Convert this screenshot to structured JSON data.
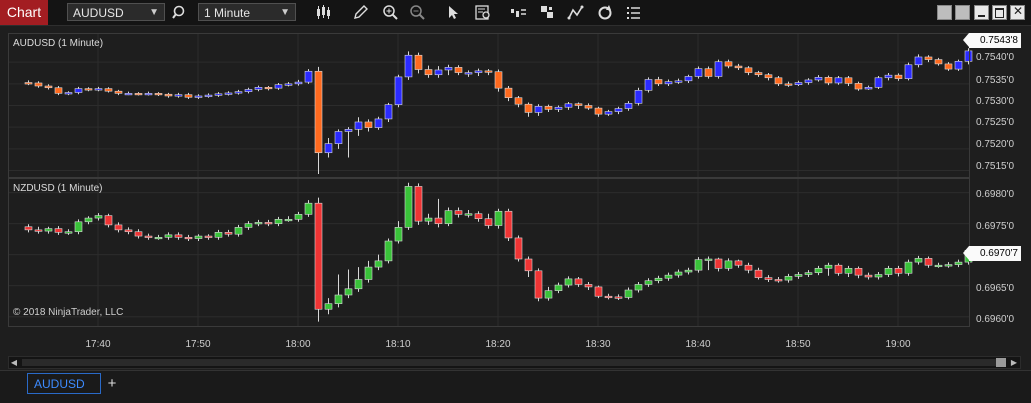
{
  "toolbar": {
    "title": "Chart",
    "instrument": "AUDUSD",
    "interval": "1 Minute"
  },
  "panels": [
    {
      "name": "AUDUSD (1 Minute)",
      "price_ticks": [
        "0.7540'0",
        "0.7535'0",
        "0.7530'0",
        "0.7525'0",
        "0.7520'0",
        "0.7515'0"
      ],
      "last_price": "0.7543'8"
    },
    {
      "name": "NZDUSD (1 Minute)",
      "price_ticks": [
        "0.6980'0",
        "0.6975'0",
        "0.6970'0",
        "0.6965'0",
        "0.6960'0"
      ],
      "last_price": "0.6970'7"
    }
  ],
  "copyright": "© 2018 NinjaTrader, LLC",
  "time_ticks": [
    "17:40",
    "17:50",
    "18:00",
    "18:10",
    "18:20",
    "18:30",
    "18:40",
    "18:50",
    "19:00"
  ],
  "tabs": [
    "AUDUSD"
  ],
  "colors": {
    "aud_up": "#2b2bff",
    "aud_down": "#ff6a1e",
    "nzd_up": "#39c239",
    "nzd_down": "#ef3434",
    "grid": "#2c2c2c"
  },
  "chart_data": [
    {
      "type": "candlestick",
      "title": "AUDUSD (1 Minute)",
      "x": [
        "17:31",
        "17:32",
        "17:33",
        "17:34",
        "17:35",
        "17:36",
        "17:37",
        "17:38",
        "17:39",
        "17:40",
        "17:41",
        "17:42",
        "17:43",
        "17:44",
        "17:45",
        "17:46",
        "17:47",
        "17:48",
        "17:49",
        "17:50",
        "17:51",
        "17:52",
        "17:53",
        "17:54",
        "17:55",
        "17:56",
        "17:57",
        "17:58",
        "17:59",
        "18:00",
        "18:01",
        "18:02",
        "18:03",
        "18:04",
        "18:05",
        "18:06",
        "18:07",
        "18:08",
        "18:09",
        "18:10",
        "18:11",
        "18:12",
        "18:13",
        "18:14",
        "18:15",
        "18:16",
        "18:17",
        "18:18",
        "18:19",
        "18:20",
        "18:21",
        "18:22",
        "18:23",
        "18:24",
        "18:25",
        "18:26",
        "18:27",
        "18:28",
        "18:29",
        "18:30",
        "18:31",
        "18:32",
        "18:33",
        "18:34",
        "18:35",
        "18:36",
        "18:37",
        "18:38",
        "18:39",
        "18:40",
        "18:41",
        "18:42",
        "18:43",
        "18:44",
        "18:45",
        "18:46",
        "18:47",
        "18:48",
        "18:49",
        "18:50",
        "18:51",
        "18:52",
        "18:53",
        "18:54",
        "18:55",
        "18:56",
        "18:57",
        "18:58",
        "18:59",
        "19:00",
        "19:01",
        "19:02",
        "19:03",
        "19:04",
        "19:05"
      ],
      "open": [
        0.75353,
        0.75352,
        0.75345,
        0.75341,
        0.75328,
        0.7533,
        0.75339,
        0.75337,
        0.75339,
        0.75333,
        0.75328,
        0.75328,
        0.75327,
        0.75328,
        0.75326,
        0.75322,
        0.75325,
        0.75319,
        0.75322,
        0.75324,
        0.75327,
        0.75329,
        0.75332,
        0.75337,
        0.75342,
        0.7534,
        0.75348,
        0.7535,
        0.75354,
        0.75379,
        0.75191,
        0.75212,
        0.7524,
        0.75245,
        0.75262,
        0.75249,
        0.75269,
        0.75302,
        0.75366,
        0.75416,
        0.75383,
        0.75371,
        0.75382,
        0.75388,
        0.75376,
        0.75376,
        0.7538,
        0.75378,
        0.7534,
        0.75318,
        0.75303,
        0.75284,
        0.75298,
        0.75291,
        0.75296,
        0.75304,
        0.753,
        0.75294,
        0.7528,
        0.75286,
        0.75293,
        0.75305,
        0.75335,
        0.7536,
        0.7535,
        0.75355,
        0.75357,
        0.75367,
        0.75385,
        0.75367,
        0.75401,
        0.75391,
        0.75387,
        0.75376,
        0.75371,
        0.75364,
        0.7535,
        0.75348,
        0.75353,
        0.75359,
        0.75365,
        0.75352,
        0.75364,
        0.75351,
        0.75338,
        0.75342,
        0.75364,
        0.7537,
        0.75362,
        0.75394,
        0.75412,
        0.75406,
        0.75396,
        0.75384,
        0.75402
      ],
      "close": [
        0.75352,
        0.75345,
        0.75341,
        0.75328,
        0.7533,
        0.75339,
        0.75337,
        0.75339,
        0.75333,
        0.75328,
        0.75328,
        0.75327,
        0.75328,
        0.75326,
        0.75322,
        0.75325,
        0.75319,
        0.75322,
        0.75324,
        0.75327,
        0.75329,
        0.75332,
        0.75337,
        0.75342,
        0.7534,
        0.75348,
        0.7535,
        0.75354,
        0.75379,
        0.75191,
        0.75212,
        0.7524,
        0.75245,
        0.75262,
        0.75249,
        0.75269,
        0.75302,
        0.75366,
        0.75416,
        0.75383,
        0.75371,
        0.75382,
        0.75388,
        0.75376,
        0.75376,
        0.7538,
        0.75378,
        0.7534,
        0.75318,
        0.75303,
        0.75284,
        0.75298,
        0.75291,
        0.75296,
        0.75304,
        0.753,
        0.75294,
        0.7528,
        0.75286,
        0.75293,
        0.75305,
        0.75335,
        0.7536,
        0.7535,
        0.75355,
        0.75357,
        0.75367,
        0.75385,
        0.75367,
        0.75401,
        0.75391,
        0.75387,
        0.75376,
        0.75371,
        0.75364,
        0.7535,
        0.75348,
        0.75353,
        0.75359,
        0.75365,
        0.75352,
        0.75364,
        0.75351,
        0.75338,
        0.75342,
        0.75364,
        0.7537,
        0.75362,
        0.75394,
        0.75412,
        0.75406,
        0.75396,
        0.75384,
        0.75402,
        0.75426
      ],
      "high": [
        0.75358,
        0.75356,
        0.75349,
        0.75345,
        0.75333,
        0.75343,
        0.75342,
        0.75343,
        0.75342,
        0.75336,
        0.75332,
        0.75331,
        0.75332,
        0.75331,
        0.75329,
        0.75329,
        0.75329,
        0.75326,
        0.75328,
        0.75331,
        0.75333,
        0.75336,
        0.75341,
        0.75346,
        0.75345,
        0.75352,
        0.75354,
        0.75359,
        0.75384,
        0.75389,
        0.75225,
        0.75245,
        0.7525,
        0.75273,
        0.75268,
        0.75274,
        0.75306,
        0.75371,
        0.75425,
        0.75422,
        0.75392,
        0.75391,
        0.75394,
        0.75393,
        0.75381,
        0.75385,
        0.75384,
        0.75383,
        0.75345,
        0.75322,
        0.75307,
        0.75303,
        0.75302,
        0.753,
        0.75308,
        0.75307,
        0.75305,
        0.75297,
        0.7529,
        0.75297,
        0.7531,
        0.75341,
        0.75365,
        0.75366,
        0.7536,
        0.75362,
        0.75371,
        0.7539,
        0.7539,
        0.75406,
        0.75406,
        0.75396,
        0.75391,
        0.7538,
        0.75375,
        0.75368,
        0.75355,
        0.75357,
        0.75363,
        0.7537,
        0.75369,
        0.75368,
        0.75368,
        0.75355,
        0.75346,
        0.75368,
        0.75375,
        0.75374,
        0.75399,
        0.75418,
        0.75416,
        0.7541,
        0.754,
        0.75406,
        0.75432
      ],
      "low": [
        0.75347,
        0.75341,
        0.75337,
        0.75324,
        0.75324,
        0.75326,
        0.75333,
        0.75333,
        0.7533,
        0.75324,
        0.75324,
        0.75323,
        0.75323,
        0.75322,
        0.75318,
        0.75318,
        0.75315,
        0.75315,
        0.75318,
        0.7532,
        0.75323,
        0.75325,
        0.75328,
        0.75333,
        0.75335,
        0.75336,
        0.75344,
        0.75346,
        0.7535,
        0.75142,
        0.7518,
        0.752,
        0.7518,
        0.7523,
        0.7524,
        0.75244,
        0.75262,
        0.75296,
        0.75359,
        0.75374,
        0.75364,
        0.75364,
        0.7537,
        0.7537,
        0.75366,
        0.75368,
        0.7537,
        0.75332,
        0.7531,
        0.75296,
        0.75274,
        0.75276,
        0.75285,
        0.75285,
        0.7529,
        0.75292,
        0.7529,
        0.75274,
        0.75276,
        0.7528,
        0.75288,
        0.753,
        0.7533,
        0.75345,
        0.75345,
        0.7535,
        0.75352,
        0.75362,
        0.75362,
        0.75362,
        0.75386,
        0.75382,
        0.7537,
        0.75366,
        0.75358,
        0.75345,
        0.75343,
        0.75345,
        0.75348,
        0.75355,
        0.75347,
        0.75348,
        0.75345,
        0.75334,
        0.75336,
        0.75338,
        0.75358,
        0.75357,
        0.75358,
        0.75388,
        0.754,
        0.75392,
        0.7538,
        0.7538,
        0.75395
      ]
    },
    {
      "type": "candlestick",
      "title": "NZDUSD (1 Minute)",
      "x": [
        "17:31",
        "17:32",
        "17:33",
        "17:34",
        "17:35",
        "17:36",
        "17:37",
        "17:38",
        "17:39",
        "17:40",
        "17:41",
        "17:42",
        "17:43",
        "17:44",
        "17:45",
        "17:46",
        "17:47",
        "17:48",
        "17:49",
        "17:50",
        "17:51",
        "17:52",
        "17:53",
        "17:54",
        "17:55",
        "17:56",
        "17:57",
        "17:58",
        "17:59",
        "18:00",
        "18:01",
        "18:02",
        "18:03",
        "18:04",
        "18:05",
        "18:06",
        "18:07",
        "18:08",
        "18:09",
        "18:10",
        "18:11",
        "18:12",
        "18:13",
        "18:14",
        "18:15",
        "18:16",
        "18:17",
        "18:18",
        "18:19",
        "18:20",
        "18:21",
        "18:22",
        "18:23",
        "18:24",
        "18:25",
        "18:26",
        "18:27",
        "18:28",
        "18:29",
        "18:30",
        "18:31",
        "18:32",
        "18:33",
        "18:34",
        "18:35",
        "18:36",
        "18:37",
        "18:38",
        "18:39",
        "18:40",
        "18:41",
        "18:42",
        "18:43",
        "18:44",
        "18:45",
        "18:46",
        "18:47",
        "18:48",
        "18:49",
        "18:50",
        "18:51",
        "18:52",
        "18:53",
        "18:54",
        "18:55",
        "18:56",
        "18:57",
        "18:58",
        "18:59",
        "19:00",
        "19:01",
        "19:02",
        "19:03",
        "19:04",
        "19:05"
      ],
      "open": [
        0.69745,
        0.6974,
        0.69738,
        0.69742,
        0.69736,
        0.69737,
        0.69753,
        0.69759,
        0.69763,
        0.69748,
        0.6974,
        0.69737,
        0.6973,
        0.69728,
        0.69728,
        0.69732,
        0.69728,
        0.69726,
        0.6973,
        0.69728,
        0.69736,
        0.69733,
        0.69744,
        0.6975,
        0.69752,
        0.6975,
        0.69757,
        0.69757,
        0.69765,
        0.69783,
        0.69612,
        0.69621,
        0.69635,
        0.69645,
        0.6966,
        0.6968,
        0.6969,
        0.69722,
        0.69744,
        0.6981,
        0.69754,
        0.69759,
        0.6975,
        0.69771,
        0.69765,
        0.69766,
        0.69758,
        0.69747,
        0.6977,
        0.69727,
        0.69693,
        0.69674,
        0.6963,
        0.69642,
        0.69651,
        0.69661,
        0.69652,
        0.69648,
        0.69633,
        0.69632,
        0.69631,
        0.69643,
        0.69652,
        0.69658,
        0.69662,
        0.69667,
        0.69672,
        0.69675,
        0.69692,
        0.69693,
        0.69678,
        0.6969,
        0.69683,
        0.69675,
        0.69663,
        0.6966,
        0.69659,
        0.69665,
        0.69668,
        0.69671,
        0.69678,
        0.69683,
        0.6967,
        0.69678,
        0.69667,
        0.69664,
        0.69668,
        0.69678,
        0.6967,
        0.69688,
        0.69694,
        0.69683,
        0.69683,
        0.69684,
        0.69688
      ],
      "close": [
        0.6974,
        0.69738,
        0.69742,
        0.69736,
        0.69737,
        0.69753,
        0.69759,
        0.69763,
        0.69748,
        0.6974,
        0.69737,
        0.6973,
        0.69728,
        0.69728,
        0.69732,
        0.69728,
        0.69726,
        0.6973,
        0.69728,
        0.69736,
        0.69733,
        0.69744,
        0.6975,
        0.69752,
        0.6975,
        0.69757,
        0.69757,
        0.69765,
        0.69783,
        0.69612,
        0.69621,
        0.69635,
        0.69645,
        0.6966,
        0.6968,
        0.6969,
        0.69722,
        0.69744,
        0.6981,
        0.69754,
        0.69759,
        0.6975,
        0.69771,
        0.69765,
        0.69766,
        0.69758,
        0.69747,
        0.6977,
        0.69727,
        0.69693,
        0.69674,
        0.6963,
        0.69642,
        0.69651,
        0.69661,
        0.69652,
        0.69648,
        0.69633,
        0.69632,
        0.69631,
        0.69643,
        0.69652,
        0.69658,
        0.69662,
        0.69667,
        0.69672,
        0.69675,
        0.69692,
        0.69693,
        0.69678,
        0.6969,
        0.69683,
        0.69675,
        0.69663,
        0.6966,
        0.69659,
        0.69665,
        0.69668,
        0.69671,
        0.69678,
        0.69683,
        0.6967,
        0.69678,
        0.69667,
        0.69664,
        0.69668,
        0.69678,
        0.6967,
        0.69688,
        0.69694,
        0.69683,
        0.69683,
        0.69684,
        0.69688,
        0.69707
      ],
      "high": [
        0.69749,
        0.69745,
        0.69745,
        0.69746,
        0.69741,
        0.69757,
        0.69762,
        0.69767,
        0.69766,
        0.69752,
        0.69744,
        0.69741,
        0.69734,
        0.69732,
        0.69736,
        0.69736,
        0.69732,
        0.69733,
        0.69733,
        0.6974,
        0.6974,
        0.69748,
        0.69754,
        0.69756,
        0.69756,
        0.69761,
        0.69762,
        0.69769,
        0.69788,
        0.69792,
        0.6963,
        0.69668,
        0.69676,
        0.6968,
        0.6969,
        0.697,
        0.69726,
        0.69754,
        0.69816,
        0.69815,
        0.69766,
        0.6979,
        0.69776,
        0.69776,
        0.69772,
        0.6977,
        0.69766,
        0.69774,
        0.69774,
        0.69731,
        0.69697,
        0.69678,
        0.69648,
        0.69655,
        0.69665,
        0.69664,
        0.69656,
        0.6965,
        0.69637,
        0.69636,
        0.69647,
        0.69656,
        0.69662,
        0.69666,
        0.69671,
        0.69676,
        0.69679,
        0.69696,
        0.69697,
        0.69695,
        0.69694,
        0.69692,
        0.69687,
        0.69679,
        0.69667,
        0.69664,
        0.69669,
        0.69672,
        0.69675,
        0.69682,
        0.69687,
        0.69686,
        0.69682,
        0.69681,
        0.69671,
        0.69672,
        0.69682,
        0.69682,
        0.69692,
        0.69698,
        0.69697,
        0.69687,
        0.69688,
        0.69692,
        0.69712
      ],
      "low": [
        0.69736,
        0.69734,
        0.69734,
        0.69732,
        0.69732,
        0.69733,
        0.69749,
        0.69755,
        0.69744,
        0.69736,
        0.69733,
        0.69726,
        0.69724,
        0.69724,
        0.69724,
        0.69724,
        0.69722,
        0.69722,
        0.69724,
        0.69724,
        0.69729,
        0.69729,
        0.6974,
        0.69746,
        0.69746,
        0.69746,
        0.69753,
        0.69753,
        0.69761,
        0.69592,
        0.69604,
        0.69615,
        0.6963,
        0.6964,
        0.69655,
        0.69675,
        0.69686,
        0.69718,
        0.6974,
        0.69748,
        0.69748,
        0.69744,
        0.69746,
        0.6976,
        0.6976,
        0.69753,
        0.69742,
        0.69742,
        0.69722,
        0.69689,
        0.69664,
        0.69625,
        0.69626,
        0.69638,
        0.69647,
        0.69648,
        0.69643,
        0.6963,
        0.69628,
        0.69627,
        0.69628,
        0.69639,
        0.69648,
        0.69654,
        0.69658,
        0.69663,
        0.69668,
        0.69671,
        0.69675,
        0.69673,
        0.69674,
        0.69679,
        0.6967,
        0.6966,
        0.69656,
        0.69655,
        0.69655,
        0.69661,
        0.69664,
        0.69667,
        0.69666,
        0.69666,
        0.69664,
        0.69662,
        0.6966,
        0.6966,
        0.69664,
        0.69665,
        0.69666,
        0.69684,
        0.69679,
        0.69679,
        0.69679,
        0.6968,
        0.69684
      ]
    }
  ]
}
